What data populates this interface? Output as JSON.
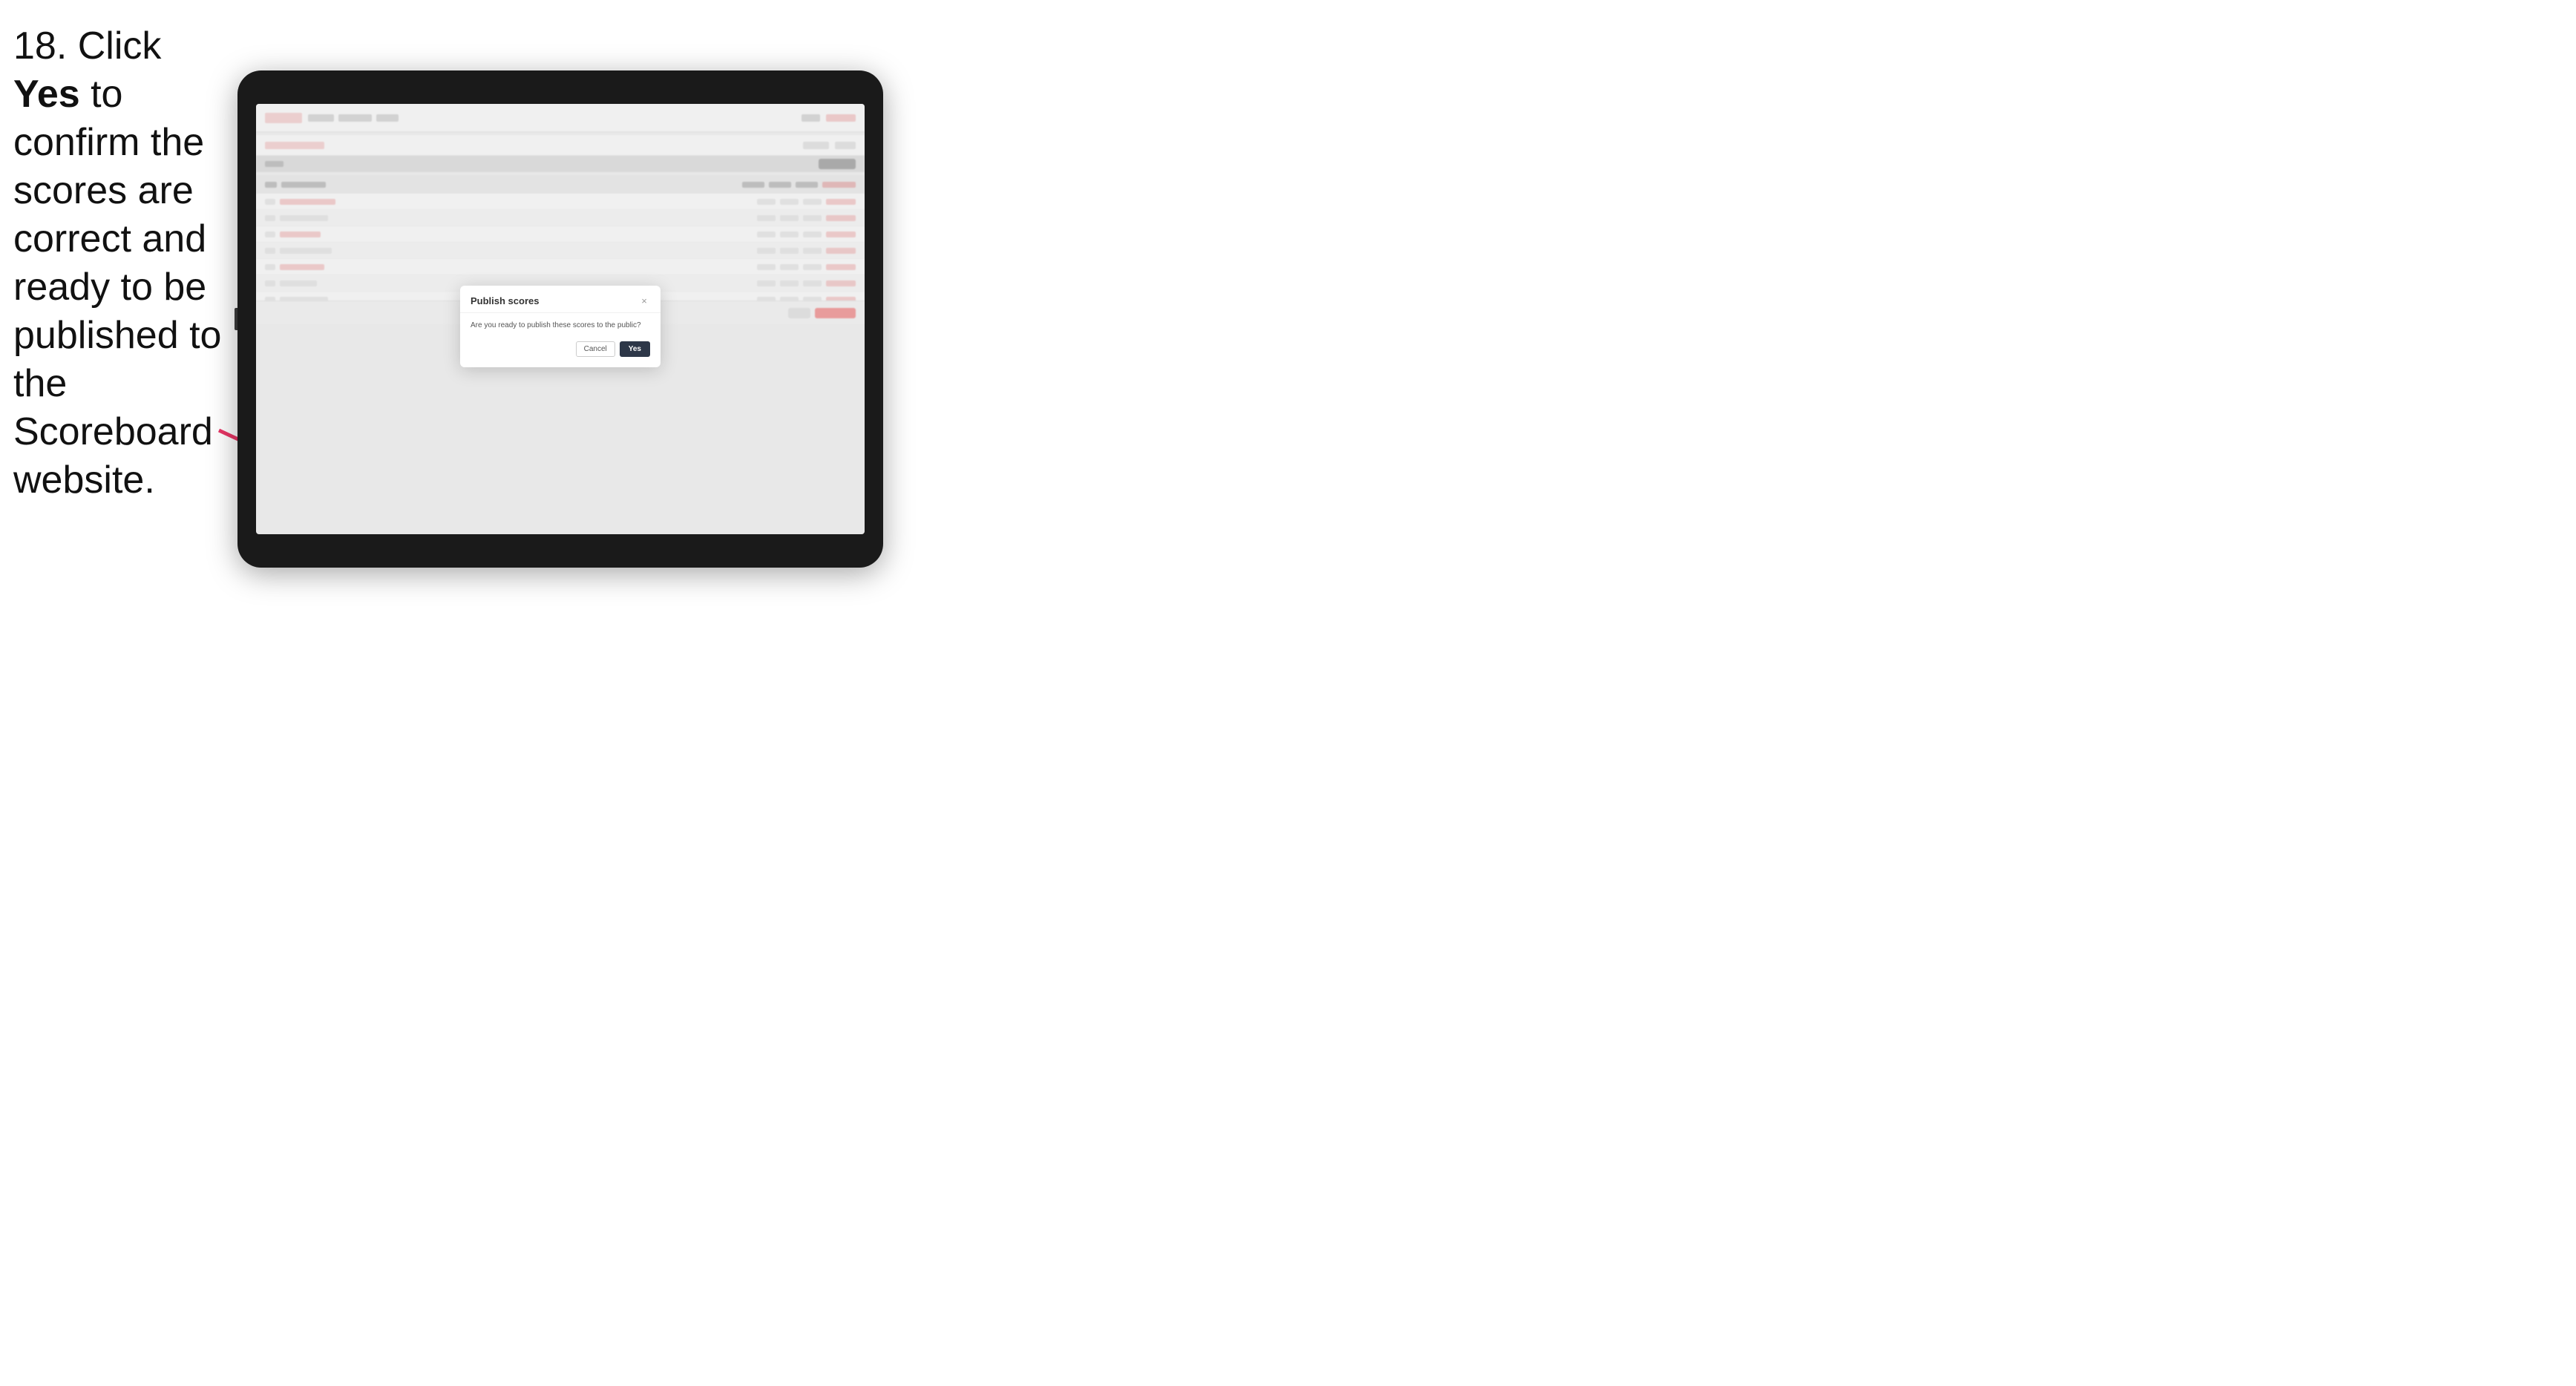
{
  "instruction": {
    "step_number": "18.",
    "text_part1": " Click ",
    "bold_text": "Yes",
    "text_part2": " to confirm the scores are correct and ready to be published to the Scoreboard website."
  },
  "dialog": {
    "title": "Publish scores",
    "message": "Are you ready to publish these scores to the public?",
    "cancel_label": "Cancel",
    "yes_label": "Yes",
    "close_icon": "×"
  },
  "arrow": {
    "color": "#e83565"
  }
}
